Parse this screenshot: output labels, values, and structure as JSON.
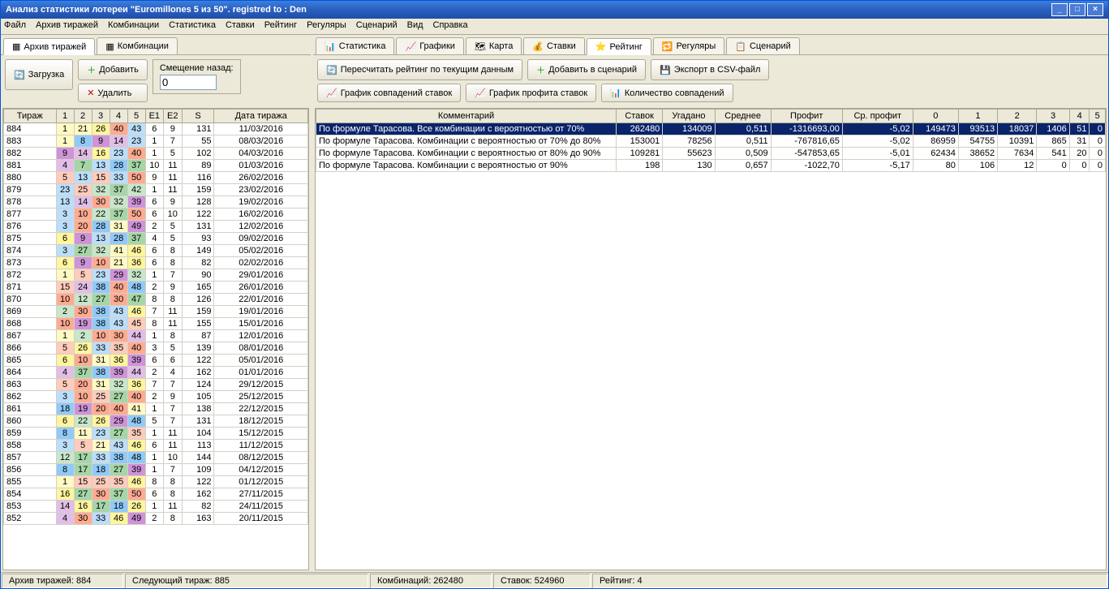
{
  "title": "Анализ статистики лотереи \"Euromillones 5 из 50\". registred to : Den",
  "menu": [
    "Файл",
    "Архив тиражей",
    "Комбинации",
    "Статистика",
    "Ставки",
    "Рейтинг",
    "Регуляры",
    "Сценарий",
    "Вид",
    "Справка"
  ],
  "left_tabs": [
    {
      "label": "Архив тиражей",
      "active": true
    },
    {
      "label": "Комбинации",
      "active": false
    }
  ],
  "left_toolbar": {
    "load": "Загрузка",
    "add": "Добавить",
    "delete": "Удалить",
    "offset_label": "Смещение назад:",
    "offset_value": "0"
  },
  "draw_headers": [
    "Тираж",
    "1",
    "2",
    "3",
    "4",
    "5",
    "E1",
    "E2",
    "S",
    "Дата тиража"
  ],
  "draws": [
    {
      "n": 884,
      "b": [
        1,
        21,
        26,
        40,
        43
      ],
      "e": [
        6,
        9
      ],
      "s": 131,
      "d": "11/03/2016"
    },
    {
      "n": 883,
      "b": [
        1,
        8,
        9,
        14,
        23
      ],
      "e": [
        1,
        7
      ],
      "s": 55,
      "d": "08/03/2016"
    },
    {
      "n": 882,
      "b": [
        9,
        14,
        16,
        23,
        40
      ],
      "e": [
        1,
        5
      ],
      "s": 102,
      "d": "04/03/2016"
    },
    {
      "n": 881,
      "b": [
        4,
        7,
        13,
        28,
        37
      ],
      "e": [
        10,
        11
      ],
      "s": 89,
      "d": "01/03/2016"
    },
    {
      "n": 880,
      "b": [
        5,
        13,
        15,
        33,
        50
      ],
      "e": [
        9,
        11
      ],
      "s": 116,
      "d": "26/02/2016"
    },
    {
      "n": 879,
      "b": [
        23,
        25,
        32,
        37,
        42
      ],
      "e": [
        1,
        11
      ],
      "s": 159,
      "d": "23/02/2016"
    },
    {
      "n": 878,
      "b": [
        13,
        14,
        30,
        32,
        39
      ],
      "e": [
        6,
        9
      ],
      "s": 128,
      "d": "19/02/2016"
    },
    {
      "n": 877,
      "b": [
        3,
        10,
        22,
        37,
        50
      ],
      "e": [
        6,
        10
      ],
      "s": 122,
      "d": "16/02/2016"
    },
    {
      "n": 876,
      "b": [
        3,
        20,
        28,
        31,
        49
      ],
      "e": [
        2,
        5
      ],
      "s": 131,
      "d": "12/02/2016"
    },
    {
      "n": 875,
      "b": [
        6,
        9,
        13,
        28,
        37
      ],
      "e": [
        4,
        5
      ],
      "s": 93,
      "d": "09/02/2016"
    },
    {
      "n": 874,
      "b": [
        3,
        27,
        32,
        41,
        46
      ],
      "e": [
        6,
        8
      ],
      "s": 149,
      "d": "05/02/2016"
    },
    {
      "n": 873,
      "b": [
        6,
        9,
        10,
        21,
        36
      ],
      "e": [
        6,
        8
      ],
      "s": 82,
      "d": "02/02/2016"
    },
    {
      "n": 872,
      "b": [
        1,
        5,
        23,
        29,
        32
      ],
      "e": [
        1,
        7
      ],
      "s": 90,
      "d": "29/01/2016"
    },
    {
      "n": 871,
      "b": [
        15,
        24,
        38,
        40,
        48
      ],
      "e": [
        2,
        9
      ],
      "s": 165,
      "d": "26/01/2016"
    },
    {
      "n": 870,
      "b": [
        10,
        12,
        27,
        30,
        47
      ],
      "e": [
        8,
        8
      ],
      "s": 126,
      "d": "22/01/2016"
    },
    {
      "n": 869,
      "b": [
        2,
        30,
        38,
        43,
        46
      ],
      "e": [
        7,
        11
      ],
      "s": 159,
      "d": "19/01/2016"
    },
    {
      "n": 868,
      "b": [
        10,
        19,
        38,
        43,
        45
      ],
      "e": [
        8,
        11
      ],
      "s": 155,
      "d": "15/01/2016"
    },
    {
      "n": 867,
      "b": [
        1,
        2,
        10,
        30,
        44
      ],
      "e": [
        1,
        8
      ],
      "s": 87,
      "d": "12/01/2016"
    },
    {
      "n": 866,
      "b": [
        5,
        26,
        33,
        35,
        40
      ],
      "e": [
        3,
        5
      ],
      "s": 139,
      "d": "08/01/2016"
    },
    {
      "n": 865,
      "b": [
        6,
        10,
        31,
        36,
        39
      ],
      "e": [
        6,
        6
      ],
      "s": 122,
      "d": "05/01/2016"
    },
    {
      "n": 864,
      "b": [
        4,
        37,
        38,
        39,
        44
      ],
      "e": [
        2,
        4
      ],
      "s": 162,
      "d": "01/01/2016"
    },
    {
      "n": 863,
      "b": [
        5,
        20,
        31,
        32,
        36
      ],
      "e": [
        7,
        7
      ],
      "s": 124,
      "d": "29/12/2015"
    },
    {
      "n": 862,
      "b": [
        3,
        10,
        25,
        27,
        40
      ],
      "e": [
        2,
        9
      ],
      "s": 105,
      "d": "25/12/2015"
    },
    {
      "n": 861,
      "b": [
        18,
        19,
        20,
        40,
        41
      ],
      "e": [
        1,
        7
      ],
      "s": 138,
      "d": "22/12/2015"
    },
    {
      "n": 860,
      "b": [
        6,
        22,
        26,
        29,
        48
      ],
      "e": [
        5,
        7
      ],
      "s": 131,
      "d": "18/12/2015"
    },
    {
      "n": 859,
      "b": [
        8,
        11,
        23,
        27,
        35
      ],
      "e": [
        1,
        11
      ],
      "s": 104,
      "d": "15/12/2015"
    },
    {
      "n": 858,
      "b": [
        3,
        5,
        21,
        43,
        46
      ],
      "e": [
        6,
        11
      ],
      "s": 113,
      "d": "11/12/2015"
    },
    {
      "n": 857,
      "b": [
        12,
        17,
        33,
        38,
        48
      ],
      "e": [
        1,
        10
      ],
      "s": 144,
      "d": "08/12/2015"
    },
    {
      "n": 856,
      "b": [
        8,
        17,
        18,
        27,
        39
      ],
      "e": [
        1,
        7
      ],
      "s": 109,
      "d": "04/12/2015"
    },
    {
      "n": 855,
      "b": [
        1,
        15,
        25,
        35,
        46
      ],
      "e": [
        8,
        8
      ],
      "s": 122,
      "d": "01/12/2015"
    },
    {
      "n": 854,
      "b": [
        16,
        27,
        30,
        37,
        50
      ],
      "e": [
        6,
        8
      ],
      "s": 162,
      "d": "27/11/2015"
    },
    {
      "n": 853,
      "b": [
        14,
        16,
        17,
        18,
        26
      ],
      "e": [
        1,
        11
      ],
      "s": 82,
      "d": "24/11/2015"
    },
    {
      "n": 852,
      "b": [
        4,
        30,
        33,
        46,
        49
      ],
      "e": [
        2,
        8
      ],
      "s": 163,
      "d": "20/11/2015"
    }
  ],
  "right_tabs": [
    {
      "label": "Статистика"
    },
    {
      "label": "Графики"
    },
    {
      "label": "Карта"
    },
    {
      "label": "Ставки"
    },
    {
      "label": "Рейтинг",
      "active": true
    },
    {
      "label": "Регуляры"
    },
    {
      "label": "Сценарий"
    }
  ],
  "right_toolbar_row1": [
    "Пересчитать рейтинг по текущим данным",
    "Добавить в сценарий",
    "Экспорт в CSV-файл"
  ],
  "right_toolbar_row2": [
    "График совпадений ставок",
    "График профита ставок",
    "Количество совпадений"
  ],
  "rating_headers": [
    "Комментарий",
    "Ставок",
    "Угадано",
    "Среднее",
    "Профит",
    "Ср. профит",
    "0",
    "1",
    "2",
    "3",
    "4",
    "5"
  ],
  "rating_rows": [
    {
      "sel": true,
      "c": "По формуле Тарасова. Все комбинации с вероятностью от 70%",
      "v": [
        "262480",
        "134009",
        "0,511",
        "-1316693,00",
        "-5,02",
        "149473",
        "93513",
        "18037",
        "1406",
        "51",
        "0"
      ]
    },
    {
      "sel": false,
      "c": "По формуле Тарасова. Комбинации с вероятностью от 70% до 80%",
      "v": [
        "153001",
        "78256",
        "0,511",
        "-767816,65",
        "-5,02",
        "86959",
        "54755",
        "10391",
        "865",
        "31",
        "0"
      ]
    },
    {
      "sel": false,
      "c": "По формуле Тарасова. Комбинации с вероятностью от 80% до 90%",
      "v": [
        "109281",
        "55623",
        "0,509",
        "-547853,65",
        "-5,01",
        "62434",
        "38652",
        "7634",
        "541",
        "20",
        "0"
      ]
    },
    {
      "sel": false,
      "c": "По формуле Тарасова. Комбинации с вероятностью от 90%",
      "v": [
        "198",
        "130",
        "0,657",
        "-1022,70",
        "-5,17",
        "80",
        "106",
        "12",
        "0",
        "0",
        "0"
      ]
    }
  ],
  "status": {
    "archive": "Архив тиражей: 884",
    "next": "Следующий тираж: 885",
    "combos": "Комбинаций: 262480",
    "bets": "Ставок: 524960",
    "rating": "Рейтинг: 4"
  }
}
